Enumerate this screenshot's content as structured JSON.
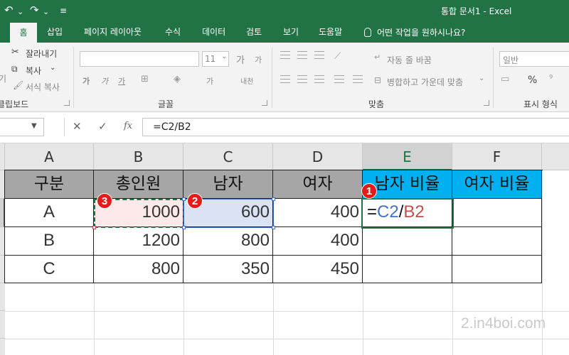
{
  "titlebar": {
    "title": "통합 문서1  -  Excel",
    "undo_icon": "↶",
    "redo_icon": "↷",
    "dropdown_icon": "⌄",
    "customize_icon": "≡"
  },
  "tabs": [
    {
      "label": "홈",
      "active": true
    },
    {
      "label": "삽입"
    },
    {
      "label": "페이지 레이아웃"
    },
    {
      "label": "수식"
    },
    {
      "label": "데이터"
    },
    {
      "label": "검토"
    },
    {
      "label": "보기"
    },
    {
      "label": "도움말"
    }
  ],
  "tellme": "어떤 작업을 원하시나요?",
  "ribbon": {
    "clipboard": {
      "cut": "잘라내기",
      "copy": "복사",
      "format_painter": "서식 복사",
      "paste_fragment": "기",
      "group_label": "클립보드"
    },
    "font": {
      "size": "11",
      "group_label": "글꼴",
      "grow": "가",
      "shrink": "가",
      "bold": "가",
      "italic": "가",
      "underline": "가",
      "fill": "가",
      "color": "가",
      "phonetic": "내천"
    },
    "alignment": {
      "wrap": "자동 줄 바꿈",
      "merge": "병합하고 가운데 맞춤",
      "group_label": "맞춤"
    },
    "number": {
      "format": "일반",
      "percent": "%",
      "group_label": "표시 형식"
    }
  },
  "formula_bar": {
    "name_box": "",
    "cancel_icon": "✕",
    "enter_icon": "✓",
    "fx_label": "fx",
    "formula": "=C2/B2"
  },
  "grid": {
    "columns": [
      "A",
      "B",
      "C",
      "D",
      "E",
      "F"
    ],
    "selected_column": "E",
    "headers": [
      "구분",
      "총인원",
      "남자",
      "여자",
      "남자 비율",
      "여자 비율"
    ],
    "rows": [
      {
        "label": "A",
        "total": "1000",
        "male": "600",
        "female": "400"
      },
      {
        "label": "B",
        "total": "1200",
        "male": "800",
        "female": "400"
      },
      {
        "label": "C",
        "total": "800",
        "male": "350",
        "female": "450"
      }
    ],
    "edit_formula": {
      "eq": "=",
      "ref1": "C2",
      "slash": "/",
      "ref2": "B2"
    }
  },
  "annotations": [
    "1",
    "2",
    "3"
  ],
  "colors": {
    "excel_green": "#217346",
    "header_gray": "#a6a6a6",
    "header_blue": "#00b0f0",
    "ref_blue": "#4472c4",
    "ref_red": "#c0504d",
    "badge_red": "#e31b1b"
  },
  "watermark": "2.in4boi.com"
}
